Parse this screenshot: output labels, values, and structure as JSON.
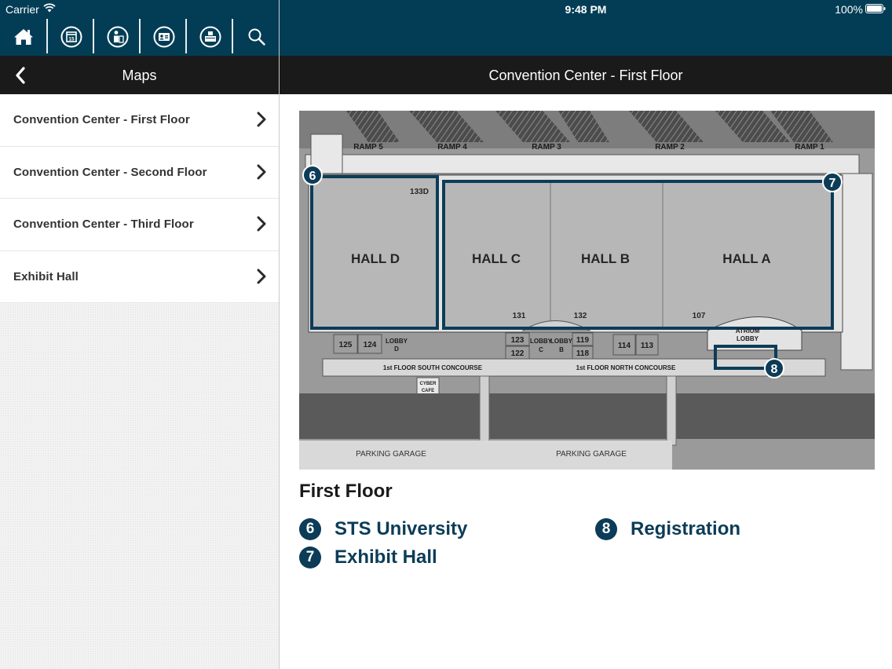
{
  "status_bar": {
    "carrier": "Carrier",
    "time": "9:48 PM",
    "battery": "100%"
  },
  "toolbar": {
    "icons": [
      "home-icon",
      "calendar-icon",
      "speaker-icon",
      "attendee-icon",
      "exhibitor-icon",
      "search-icon"
    ],
    "calendar_day": "15"
  },
  "left_nav": {
    "title": "Maps"
  },
  "map_list": {
    "items": [
      {
        "label": "Convention Center - First Floor"
      },
      {
        "label": "Convention Center - Second Floor"
      },
      {
        "label": "Convention Center - Third Floor"
      },
      {
        "label": "Exhibit Hall"
      }
    ]
  },
  "right_nav": {
    "title": "Convention Center - First Floor"
  },
  "floor_map": {
    "ramps": [
      "RAMP 5",
      "RAMP 4",
      "RAMP 3",
      "RAMP 2",
      "RAMP 1"
    ],
    "halls": [
      "HALL D",
      "HALL C",
      "HALL B",
      "HALL A"
    ],
    "rooms": [
      "133D",
      "131",
      "132",
      "107",
      "125",
      "124",
      "123",
      "122",
      "119",
      "118",
      "114",
      "113"
    ],
    "lobbies": {
      "lobby_d": [
        "LOBBY",
        "D"
      ],
      "lobby_c": [
        "LOBBY",
        "C"
      ],
      "lobby_b": [
        "LOBBY",
        "B"
      ],
      "atrium": [
        "ATRIUM",
        "LOBBY"
      ]
    },
    "concourses": [
      "1st FLOOR SOUTH CONCOURSE",
      "1st FLOOR NORTH CONCOURSE"
    ],
    "cyber_cafe": [
      "CYBER",
      "CAFE"
    ],
    "parking": [
      "PARKING GARAGE",
      "PARKING GARAGE"
    ],
    "markers": [
      "6",
      "7",
      "8"
    ],
    "accent_color": "#0c3c57"
  },
  "legend": {
    "title": "First Floor",
    "items": [
      {
        "number": "6",
        "label": "STS University"
      },
      {
        "number": "7",
        "label": "Exhibit Hall"
      },
      {
        "number": "8",
        "label": "Registration"
      }
    ]
  }
}
